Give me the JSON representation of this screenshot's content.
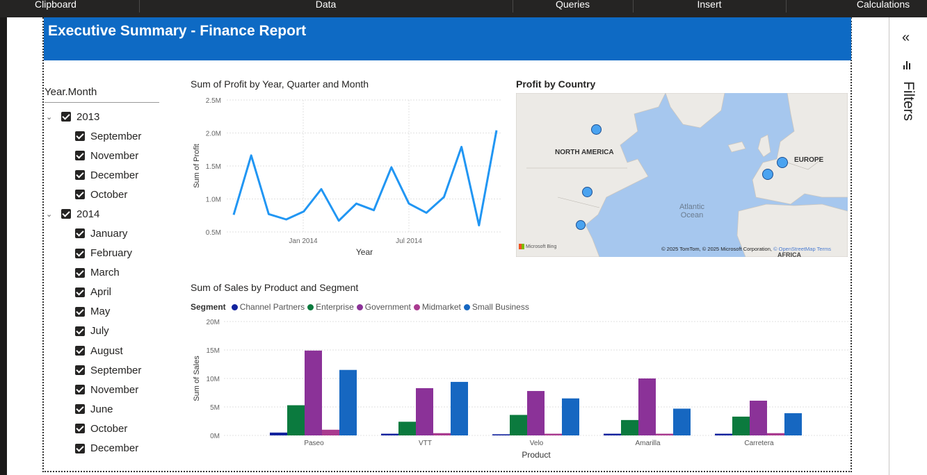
{
  "ribbon": {
    "groups": [
      "Clipboard",
      "Data",
      "Queries",
      "Insert",
      "Calculations"
    ]
  },
  "report": {
    "title": "Executive Summary - Finance Report"
  },
  "filters_pane": {
    "label": "Filters",
    "collapse_icon": "double-chevron-left-icon",
    "filter_icon": "filter-icon"
  },
  "slicer": {
    "title": "Year.Month",
    "years": [
      {
        "label": "2013",
        "months": [
          "September",
          "November",
          "December",
          "October"
        ]
      },
      {
        "label": "2014",
        "months": [
          "January",
          "February",
          "March",
          "April",
          "May",
          "July",
          "August",
          "September",
          "November",
          "June",
          "October",
          "December"
        ]
      }
    ]
  },
  "profit_chart": {
    "title": "Sum of Profit by Year, Quarter and Month",
    "chart_data": {
      "type": "line",
      "xlabel": "Year",
      "ylabel": "Sum of Profit",
      "yticks": [
        "2.5M",
        "2.0M",
        "1.5M",
        "1.0M",
        "0.5M"
      ],
      "xticks": [
        "Jan 2014",
        "Jul 2014"
      ],
      "ylim": [
        0.5,
        2.5
      ],
      "grid": true,
      "color": "#2196F3",
      "series": [
        {
          "values": [
            0.76,
            1.66,
            0.77,
            0.69,
            0.81,
            1.15,
            0.67,
            0.93,
            0.83,
            1.48,
            0.93,
            0.79,
            1.03,
            1.79,
            0.6,
            2.04
          ]
        }
      ]
    }
  },
  "map_visual": {
    "title": "Profit by Country",
    "labels": {
      "north_america": "NORTH AMERICA",
      "europe": "EUROPE",
      "ocean": "Atlantic Ocean",
      "africa": "AFRICA"
    },
    "logo": "Microsoft Bing",
    "attribution": "© 2025 TomTom, © 2025 Microsoft Corporation,",
    "osm_link": "© OpenStreetMap",
    "terms_link": "Terms",
    "bubble_color": "#4aa3f0"
  },
  "sales_chart": {
    "title": "Sum of Sales by Product and Segment",
    "legend_title": "Segment",
    "chart_data": {
      "type": "bar",
      "xlabel": "Product",
      "ylabel": "Sum of Sales",
      "ylim": [
        0,
        20
      ],
      "yticks": [
        "20M",
        "15M",
        "10M",
        "5M",
        "0M"
      ],
      "categories": [
        "Paseo",
        "VTT",
        "Velo",
        "Amarilla",
        "Carretera"
      ],
      "series": [
        {
          "name": "Channel Partners",
          "color": "#12239e",
          "values": [
            0.5,
            0.3,
            0.2,
            0.3,
            0.3
          ]
        },
        {
          "name": "Enterprise",
          "color": "#0b7a3e",
          "values": [
            5.3,
            2.4,
            3.6,
            2.7,
            3.3
          ]
        },
        {
          "name": "Government",
          "color": "#8b3298",
          "values": [
            14.9,
            8.3,
            7.8,
            10.0,
            6.1
          ]
        },
        {
          "name": "Midmarket",
          "color": "#a93a8f",
          "values": [
            1.0,
            0.4,
            0.3,
            0.3,
            0.4
          ]
        },
        {
          "name": "Small Business",
          "color": "#1667c1",
          "values": [
            11.5,
            9.4,
            6.5,
            4.7,
            3.9
          ]
        }
      ]
    }
  }
}
